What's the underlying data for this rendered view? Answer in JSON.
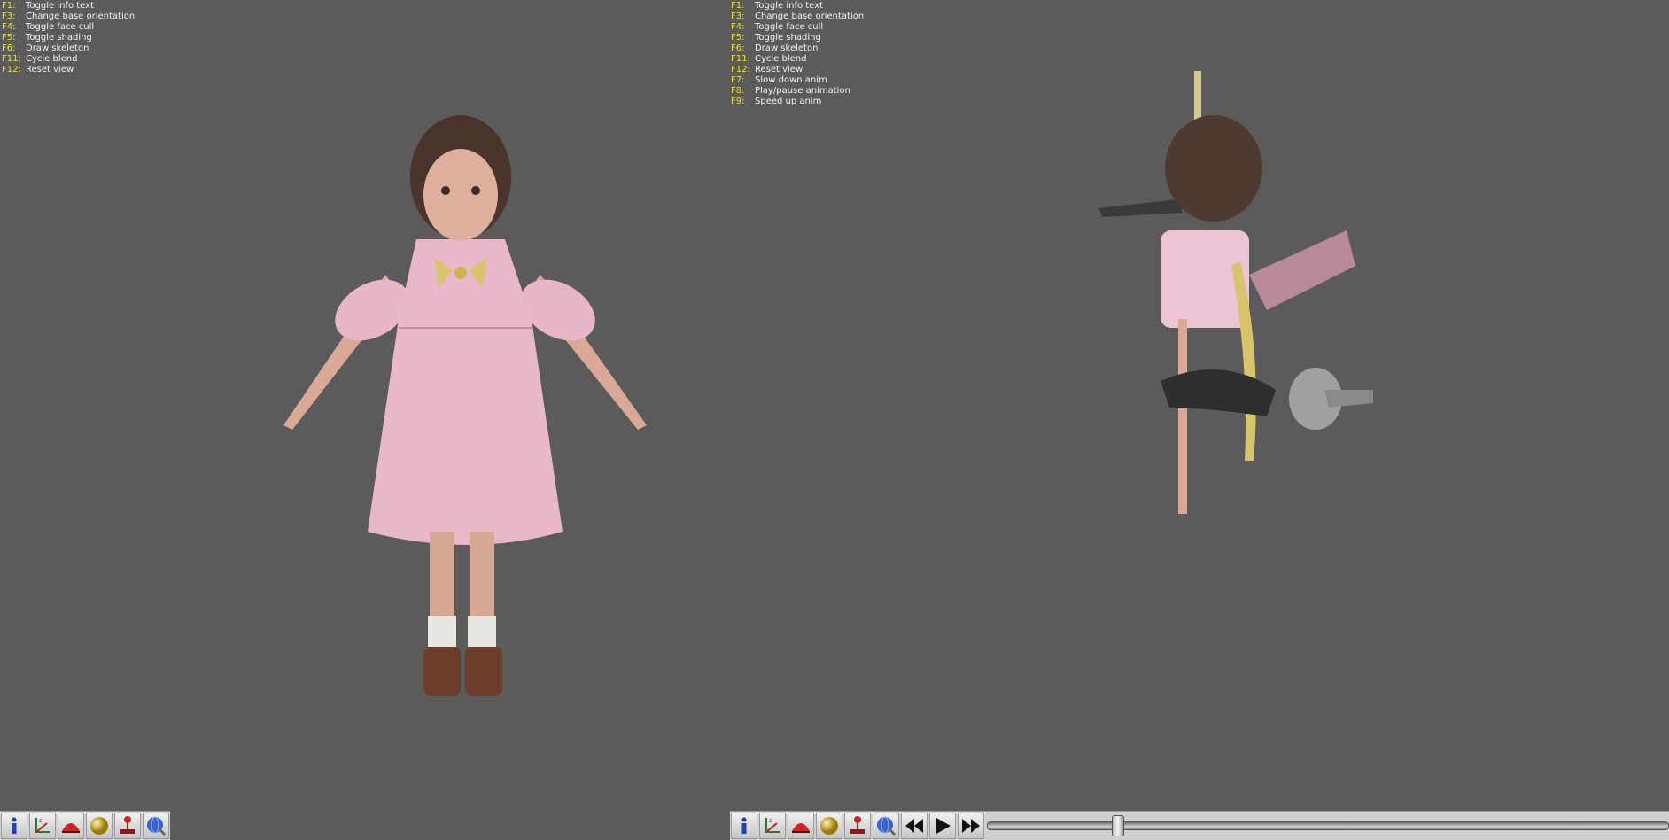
{
  "help_left": [
    {
      "key": "F1:",
      "desc": "Toggle info text"
    },
    {
      "key": "F3:",
      "desc": "Change base orientation"
    },
    {
      "key": "F4:",
      "desc": "Toggle face cull"
    },
    {
      "key": "F5:",
      "desc": "Toggle shading"
    },
    {
      "key": "F6:",
      "desc": "Draw skeleton"
    },
    {
      "key": "F11:",
      "desc": "Cycle blend"
    },
    {
      "key": "F12:",
      "desc": "Reset view"
    }
  ],
  "help_right": [
    {
      "key": "F1:",
      "desc": "Toggle info text"
    },
    {
      "key": "F3:",
      "desc": "Change base orientation"
    },
    {
      "key": "F4:",
      "desc": "Toggle face cull"
    },
    {
      "key": "F5:",
      "desc": "Toggle shading"
    },
    {
      "key": "F6:",
      "desc": "Draw skeleton"
    },
    {
      "key": "F11:",
      "desc": "Cycle blend"
    },
    {
      "key": "F12:",
      "desc": "Reset view"
    },
    {
      "key": "F7:",
      "desc": "Slow down anim"
    },
    {
      "key": "F8:",
      "desc": "Play/pause animation"
    },
    {
      "key": "F9:",
      "desc": "Speed up anim"
    }
  ],
  "toolbar_left": [
    "info-icon",
    "axes-icon",
    "dome-icon",
    "sphere-icon",
    "joystick-icon",
    "globe-icon"
  ],
  "toolbar_right": [
    "info-icon",
    "axes-icon",
    "dome-icon",
    "sphere-icon",
    "joystick-icon",
    "globe-icon",
    "rewind-icon",
    "play-icon",
    "fast-forward-icon"
  ],
  "animation": {
    "position": 0.19
  },
  "colors": {
    "background": "#5b5b5b",
    "key_text": "#e8e23a",
    "desc_text": "#f2f2f2"
  }
}
